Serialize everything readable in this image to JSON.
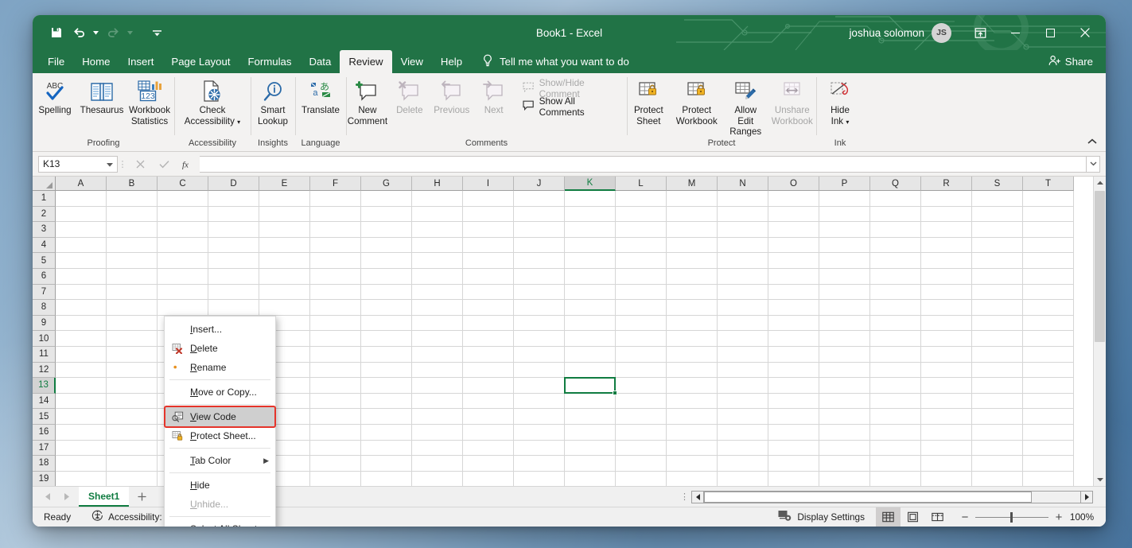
{
  "window": {
    "document_title": "Book1",
    "app_name": "Excel",
    "title_separator": "-",
    "user_name": "joshua solomon",
    "avatar_initials": "JS",
    "accent_color": "#217346"
  },
  "quick_access": [
    {
      "name": "save",
      "icon": "save-icon"
    },
    {
      "name": "undo",
      "icon": "undo-icon"
    },
    {
      "name": "redo",
      "icon": "redo-icon"
    },
    {
      "name": "customize",
      "icon": "customize-quick-access-icon"
    }
  ],
  "window_controls": {
    "ribbon_display_options": "ribbon-display-options-icon",
    "minimize": "minimize-icon",
    "maximize": "maximize-icon",
    "close": "close-icon"
  },
  "ribbon_tabs": [
    {
      "label": "File",
      "active": false
    },
    {
      "label": "Home",
      "active": false
    },
    {
      "label": "Insert",
      "active": false
    },
    {
      "label": "Page Layout",
      "active": false
    },
    {
      "label": "Formulas",
      "active": false
    },
    {
      "label": "Data",
      "active": false
    },
    {
      "label": "Review",
      "active": true
    },
    {
      "label": "View",
      "active": false
    },
    {
      "label": "Help",
      "active": false
    }
  ],
  "tell_me": {
    "label": "Tell me what you want to do",
    "icon": "lightbulb-icon"
  },
  "share": {
    "label": "Share",
    "icon": "share-person-icon"
  },
  "ribbon": {
    "collapse_icon": "chevron-up-icon",
    "groups": [
      {
        "name": "proofing",
        "label": "Proofing",
        "buttons": [
          {
            "label_line1": "Spelling",
            "label_line2": "",
            "icon": "spelling-abc-check-icon",
            "disabled": false
          },
          {
            "label_line1": "Thesaurus",
            "label_line2": "",
            "icon": "thesaurus-book-icon",
            "disabled": false
          },
          {
            "label_line1": "Workbook",
            "label_line2": "Statistics",
            "icon": "workbook-statistics-icon",
            "disabled": false
          }
        ]
      },
      {
        "name": "accessibility",
        "label": "Accessibility",
        "buttons": [
          {
            "label_line1": "Check",
            "label_line2": "Accessibility",
            "icon": "check-accessibility-icon",
            "disabled": false,
            "has_dropdown": true
          }
        ]
      },
      {
        "name": "insights",
        "label": "Insights",
        "buttons": [
          {
            "label_line1": "Smart",
            "label_line2": "Lookup",
            "icon": "smart-lookup-magnifier-icon",
            "disabled": false
          }
        ]
      },
      {
        "name": "language",
        "label": "Language",
        "buttons": [
          {
            "label_line1": "Translate",
            "label_line2": "",
            "icon": "translate-icon",
            "disabled": false
          }
        ]
      },
      {
        "name": "comments",
        "label": "Comments",
        "buttons": [
          {
            "label_line1": "New",
            "label_line2": "Comment",
            "icon": "new-comment-icon",
            "disabled": false
          },
          {
            "label_line1": "Delete",
            "label_line2": "",
            "icon": "delete-comment-icon",
            "disabled": true
          },
          {
            "label_line1": "Previous",
            "label_line2": "",
            "icon": "previous-comment-icon",
            "disabled": true
          },
          {
            "label_line1": "Next",
            "label_line2": "",
            "icon": "next-comment-icon",
            "disabled": true
          }
        ],
        "small_buttons": [
          {
            "label": "Show/Hide Comment",
            "icon": "show-hide-comment-icon",
            "disabled": true
          },
          {
            "label": "Show All Comments",
            "icon": "show-all-comments-icon",
            "disabled": false
          }
        ]
      },
      {
        "name": "protect",
        "label": "Protect",
        "buttons": [
          {
            "label_line1": "Protect",
            "label_line2": "Sheet",
            "icon": "protect-sheet-icon",
            "disabled": false
          },
          {
            "label_line1": "Protect",
            "label_line2": "Workbook",
            "icon": "protect-workbook-icon",
            "disabled": false
          },
          {
            "label_line1": "Allow Edit",
            "label_line2": "Ranges",
            "icon": "allow-edit-ranges-icon",
            "disabled": false
          },
          {
            "label_line1": "Unshare",
            "label_line2": "Workbook",
            "icon": "unshare-workbook-icon",
            "disabled": true
          }
        ]
      },
      {
        "name": "ink",
        "label": "Ink",
        "buttons": [
          {
            "label_line1": "Hide",
            "label_line2": "Ink",
            "icon": "hide-ink-icon",
            "disabled": false,
            "has_dropdown": true
          }
        ]
      }
    ]
  },
  "formula_bar": {
    "name_box_value": "K13",
    "name_box_caret": "chevron-down-icon",
    "cancel_icon": "cancel-x-icon",
    "enter_icon": "enter-check-icon",
    "function_icon": "insert-function-fx-icon",
    "formula_value": "",
    "expand_icon": "chevron-down-icon"
  },
  "grid": {
    "columns": [
      "A",
      "B",
      "C",
      "D",
      "E",
      "F",
      "G",
      "H",
      "I",
      "J",
      "K",
      "L",
      "M",
      "N",
      "O",
      "P",
      "Q",
      "R",
      "S",
      "T"
    ],
    "rows": [
      1,
      2,
      3,
      4,
      5,
      6,
      7,
      8,
      9,
      10,
      11,
      12,
      13,
      14,
      15,
      16,
      17,
      18,
      19
    ],
    "active_cell": {
      "column": "K",
      "row": 13
    }
  },
  "sheet_bar": {
    "nav_first_icon": "nav-first-sheet-icon",
    "nav_prev_icon": "nav-previous-sheet-icon",
    "tabs": [
      {
        "label": "Sheet1",
        "active": true
      }
    ],
    "add_sheet_icon": "add-sheet-plus-icon"
  },
  "context_menu": {
    "items": [
      {
        "label": "Insert...",
        "icon": "",
        "disabled": false,
        "highlighted": false,
        "accel": "I"
      },
      {
        "label": "Delete",
        "icon": "delete-sheet-icon",
        "disabled": false,
        "highlighted": false,
        "accel": "D"
      },
      {
        "label": "Rename",
        "icon": "rename-sheet-icon",
        "disabled": false,
        "highlighted": false,
        "accel": "R"
      },
      {
        "label": "Move or Copy...",
        "icon": "",
        "disabled": false,
        "highlighted": false,
        "accel": "M"
      },
      {
        "label": "View Code",
        "icon": "view-code-icon",
        "disabled": false,
        "highlighted": true,
        "accel": "V"
      },
      {
        "label": "Protect Sheet...",
        "icon": "protect-sheet-small-icon",
        "disabled": false,
        "highlighted": false,
        "accel": "P"
      },
      {
        "label": "Tab Color",
        "icon": "",
        "disabled": false,
        "highlighted": false,
        "accel": "T",
        "submenu": true
      },
      {
        "label": "Hide",
        "icon": "",
        "disabled": false,
        "highlighted": false,
        "accel": "H"
      },
      {
        "label": "Unhide...",
        "icon": "",
        "disabled": true,
        "highlighted": false,
        "accel": "U"
      },
      {
        "label": "Select All Sheets",
        "icon": "",
        "disabled": false,
        "highlighted": false,
        "accel": "S"
      }
    ],
    "highlight_color": "#e5342a"
  },
  "status_bar": {
    "ready_label": "Ready",
    "accessibility_label": "Accessibility: Good to go",
    "accessibility_icon": "accessibility-icon",
    "display_settings_label": "Display Settings",
    "display_settings_icon": "display-settings-icon",
    "views": [
      {
        "name": "normal-view",
        "icon": "normal-view-icon",
        "active": true
      },
      {
        "name": "page-layout-view",
        "icon": "page-layout-view-icon",
        "active": false
      },
      {
        "name": "page-break-preview",
        "icon": "page-break-preview-icon",
        "active": false
      }
    ],
    "zoom_out_label": "−",
    "zoom_in_label": "+",
    "zoom_level": "100%"
  }
}
